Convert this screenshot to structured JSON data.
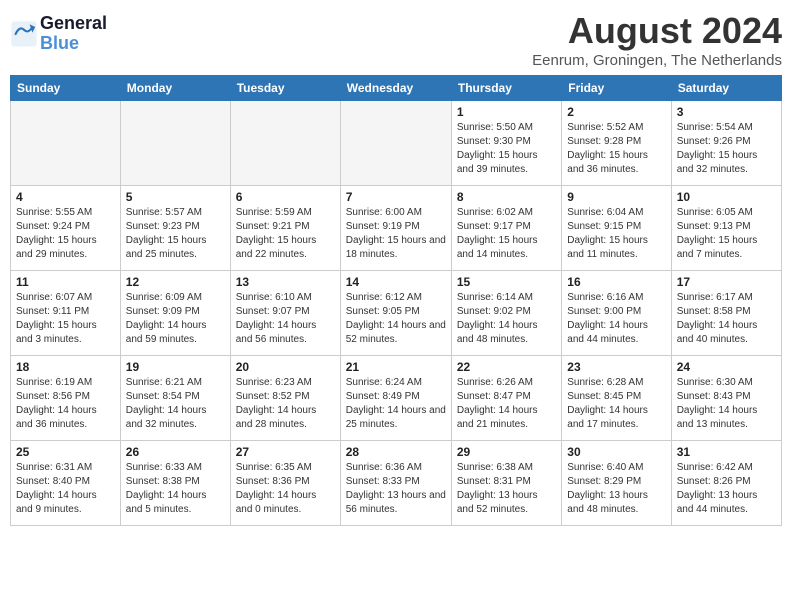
{
  "header": {
    "logo_line1": "General",
    "logo_line2": "Blue",
    "title": "August 2024",
    "subtitle": "Eenrum, Groningen, The Netherlands"
  },
  "weekdays": [
    "Sunday",
    "Monday",
    "Tuesday",
    "Wednesday",
    "Thursday",
    "Friday",
    "Saturday"
  ],
  "weeks": [
    [
      {
        "day": "",
        "empty": true
      },
      {
        "day": "",
        "empty": true
      },
      {
        "day": "",
        "empty": true
      },
      {
        "day": "",
        "empty": true
      },
      {
        "day": "1",
        "sunrise": "5:50 AM",
        "sunset": "9:30 PM",
        "daylight": "15 hours and 39 minutes."
      },
      {
        "day": "2",
        "sunrise": "5:52 AM",
        "sunset": "9:28 PM",
        "daylight": "15 hours and 36 minutes."
      },
      {
        "day": "3",
        "sunrise": "5:54 AM",
        "sunset": "9:26 PM",
        "daylight": "15 hours and 32 minutes."
      }
    ],
    [
      {
        "day": "4",
        "sunrise": "5:55 AM",
        "sunset": "9:24 PM",
        "daylight": "15 hours and 29 minutes."
      },
      {
        "day": "5",
        "sunrise": "5:57 AM",
        "sunset": "9:23 PM",
        "daylight": "15 hours and 25 minutes."
      },
      {
        "day": "6",
        "sunrise": "5:59 AM",
        "sunset": "9:21 PM",
        "daylight": "15 hours and 22 minutes."
      },
      {
        "day": "7",
        "sunrise": "6:00 AM",
        "sunset": "9:19 PM",
        "daylight": "15 hours and 18 minutes."
      },
      {
        "day": "8",
        "sunrise": "6:02 AM",
        "sunset": "9:17 PM",
        "daylight": "15 hours and 14 minutes."
      },
      {
        "day": "9",
        "sunrise": "6:04 AM",
        "sunset": "9:15 PM",
        "daylight": "15 hours and 11 minutes."
      },
      {
        "day": "10",
        "sunrise": "6:05 AM",
        "sunset": "9:13 PM",
        "daylight": "15 hours and 7 minutes."
      }
    ],
    [
      {
        "day": "11",
        "sunrise": "6:07 AM",
        "sunset": "9:11 PM",
        "daylight": "15 hours and 3 minutes."
      },
      {
        "day": "12",
        "sunrise": "6:09 AM",
        "sunset": "9:09 PM",
        "daylight": "14 hours and 59 minutes."
      },
      {
        "day": "13",
        "sunrise": "6:10 AM",
        "sunset": "9:07 PM",
        "daylight": "14 hours and 56 minutes."
      },
      {
        "day": "14",
        "sunrise": "6:12 AM",
        "sunset": "9:05 PM",
        "daylight": "14 hours and 52 minutes."
      },
      {
        "day": "15",
        "sunrise": "6:14 AM",
        "sunset": "9:02 PM",
        "daylight": "14 hours and 48 minutes."
      },
      {
        "day": "16",
        "sunrise": "6:16 AM",
        "sunset": "9:00 PM",
        "daylight": "14 hours and 44 minutes."
      },
      {
        "day": "17",
        "sunrise": "6:17 AM",
        "sunset": "8:58 PM",
        "daylight": "14 hours and 40 minutes."
      }
    ],
    [
      {
        "day": "18",
        "sunrise": "6:19 AM",
        "sunset": "8:56 PM",
        "daylight": "14 hours and 36 minutes."
      },
      {
        "day": "19",
        "sunrise": "6:21 AM",
        "sunset": "8:54 PM",
        "daylight": "14 hours and 32 minutes."
      },
      {
        "day": "20",
        "sunrise": "6:23 AM",
        "sunset": "8:52 PM",
        "daylight": "14 hours and 28 minutes."
      },
      {
        "day": "21",
        "sunrise": "6:24 AM",
        "sunset": "8:49 PM",
        "daylight": "14 hours and 25 minutes."
      },
      {
        "day": "22",
        "sunrise": "6:26 AM",
        "sunset": "8:47 PM",
        "daylight": "14 hours and 21 minutes."
      },
      {
        "day": "23",
        "sunrise": "6:28 AM",
        "sunset": "8:45 PM",
        "daylight": "14 hours and 17 minutes."
      },
      {
        "day": "24",
        "sunrise": "6:30 AM",
        "sunset": "8:43 PM",
        "daylight": "14 hours and 13 minutes."
      }
    ],
    [
      {
        "day": "25",
        "sunrise": "6:31 AM",
        "sunset": "8:40 PM",
        "daylight": "14 hours and 9 minutes."
      },
      {
        "day": "26",
        "sunrise": "6:33 AM",
        "sunset": "8:38 PM",
        "daylight": "14 hours and 5 minutes."
      },
      {
        "day": "27",
        "sunrise": "6:35 AM",
        "sunset": "8:36 PM",
        "daylight": "14 hours and 0 minutes."
      },
      {
        "day": "28",
        "sunrise": "6:36 AM",
        "sunset": "8:33 PM",
        "daylight": "13 hours and 56 minutes."
      },
      {
        "day": "29",
        "sunrise": "6:38 AM",
        "sunset": "8:31 PM",
        "daylight": "13 hours and 52 minutes."
      },
      {
        "day": "30",
        "sunrise": "6:40 AM",
        "sunset": "8:29 PM",
        "daylight": "13 hours and 48 minutes."
      },
      {
        "day": "31",
        "sunrise": "6:42 AM",
        "sunset": "8:26 PM",
        "daylight": "13 hours and 44 minutes."
      }
    ]
  ]
}
